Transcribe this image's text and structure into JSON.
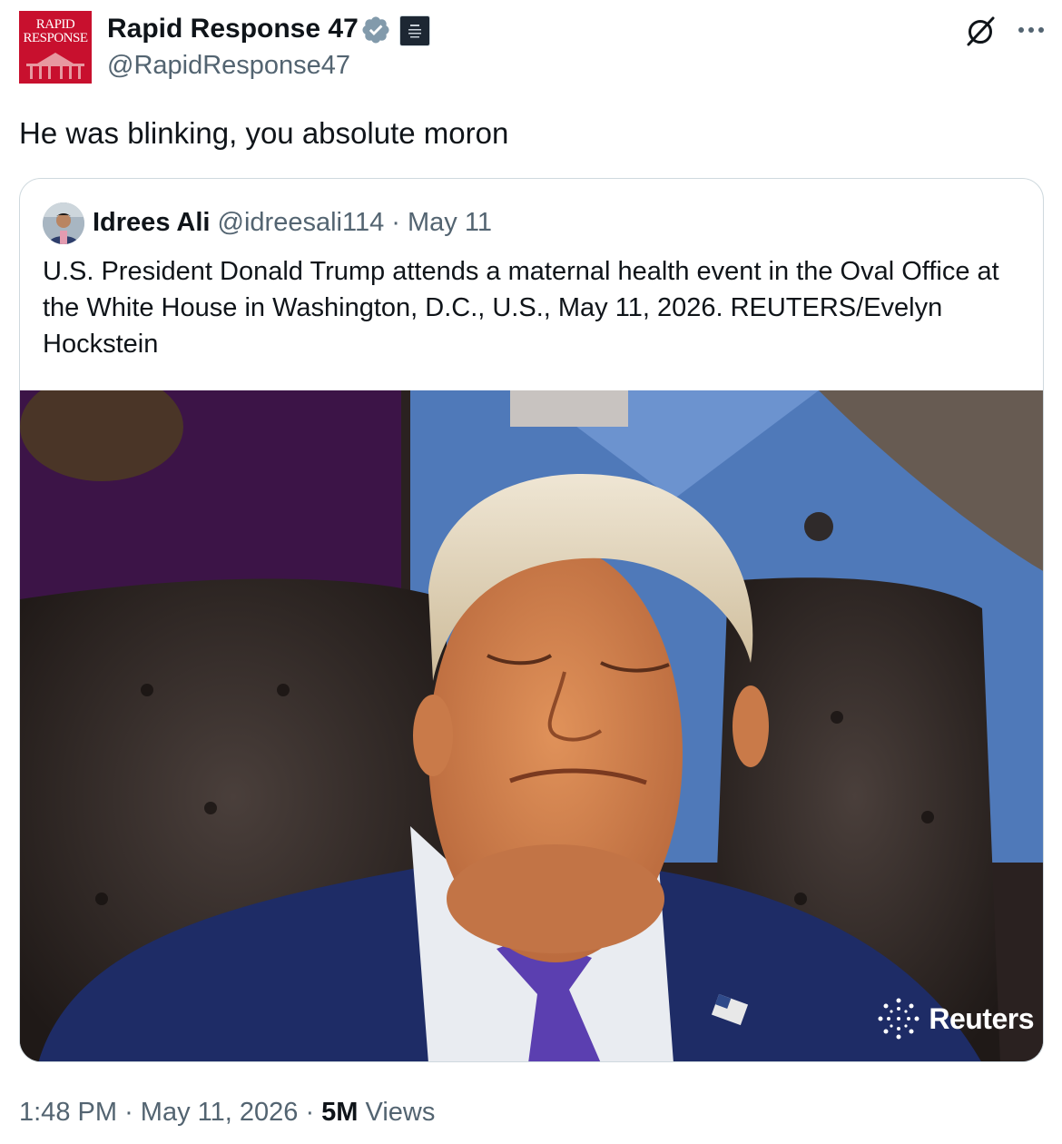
{
  "post": {
    "author": {
      "name": "Rapid Response 47",
      "handle": "@RapidResponse47",
      "avatar_text_line1": "RAPID",
      "avatar_text_line2": "RESPONSE",
      "avatar_color": "#c8102e",
      "verified_color": "#829aab"
    },
    "text": "He was blinking, you absolute moron",
    "icons": {
      "grok": "grok-icon",
      "more": "more-icon",
      "verified": "verified-badge-icon"
    }
  },
  "quote": {
    "name": "Idrees Ali",
    "handle": "@idreesali114",
    "separator": "·",
    "date": "May 11",
    "text": "U.S. President Donald Trump attends a maternal health event in the Oval Office at the White House in Washington, D.C., U.S., May 11, 2026. REUTERS/Evelyn Hockstein",
    "photo_watermark": "Reuters"
  },
  "meta": {
    "time": "1:48 PM",
    "date": "May 11, 2026",
    "separator": "·",
    "views_count": "5M",
    "views_label": "Views"
  },
  "colors": {
    "text": "#0f1419",
    "secondary": "#536471",
    "border": "#cfd9de"
  }
}
